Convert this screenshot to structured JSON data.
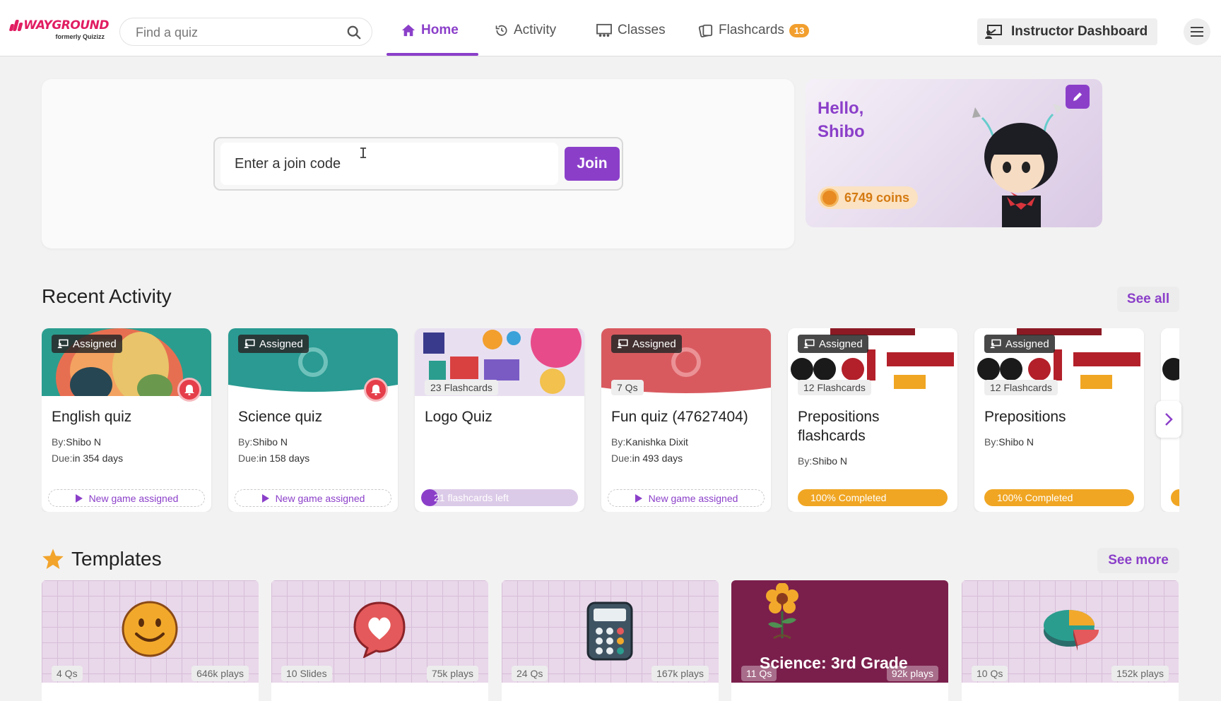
{
  "brand": {
    "name": "WAYGROUND",
    "sub": "formerly Quizizz",
    "color": "#e11d62"
  },
  "search": {
    "placeholder": "Find a quiz",
    "icon": "search-icon"
  },
  "nav": {
    "items": [
      {
        "label": "Home",
        "icon": "home-icon",
        "active": true
      },
      {
        "label": "Activity",
        "icon": "history-icon",
        "active": false
      },
      {
        "label": "Classes",
        "icon": "classes-icon",
        "active": false
      },
      {
        "label": "Flashcards",
        "icon": "flashcards-icon",
        "active": false,
        "badge": "13"
      }
    ],
    "instructor_label": "Instructor Dashboard",
    "menu_icon": "hamburger-icon"
  },
  "join": {
    "placeholder": "Enter a join code",
    "button": "Join"
  },
  "profile": {
    "greeting_line1": "Hello,",
    "greeting_line2": "Shibo",
    "coins": "6749 coins"
  },
  "recent": {
    "title": "Recent Activity",
    "see_all": "See all",
    "cards": [
      {
        "tag": "Assigned",
        "title": "English quiz",
        "by_label": "By:",
        "by": "Shibo N",
        "due_label": "Due:",
        "due": "in 354 days",
        "action": "New game assigned"
      },
      {
        "tag": "Assigned",
        "title": "Science quiz",
        "by_label": "By:",
        "by": "Shibo N",
        "due_label": "Due:",
        "due": "in 158 days",
        "action": "New game assigned"
      },
      {
        "count": "23 Flashcards",
        "title": "Logo Quiz",
        "progress_label": "21 flashcards left",
        "progress": 0.09
      },
      {
        "tag": "Assigned",
        "count": "7 Qs",
        "title": "Fun quiz (47627404)",
        "by_label": "By:",
        "by": "Kanishka Dixit",
        "due_label": "Due:",
        "due": "in 493 days",
        "action": "New game assigned"
      },
      {
        "tag": "Assigned",
        "count": "12 Flashcards",
        "title": "Prepositions flashcards",
        "by_label": "By:",
        "by": "Shibo N",
        "complete": "100% Completed"
      },
      {
        "tag": "Assigned",
        "count": "12 Flashcards",
        "title": "Prepositions",
        "by_label": "By:",
        "by": "Shibo N",
        "complete": "100% Completed"
      }
    ]
  },
  "templates": {
    "title": "Templates",
    "see_more": "See more",
    "items": [
      {
        "left": "4 Qs",
        "right": "646k plays",
        "icon": "smiley-icon"
      },
      {
        "left": "10 Slides",
        "right": "75k plays",
        "icon": "heart-bubble-icon"
      },
      {
        "left": "24 Qs",
        "right": "167k plays",
        "icon": "calculator-icon"
      },
      {
        "left": "11 Qs",
        "right": "92k plays",
        "icon": "flower-icon",
        "title": "Science: 3rd Grade"
      },
      {
        "left": "10 Qs",
        "right": "152k plays",
        "icon": "pie-chart-icon"
      }
    ]
  },
  "colors": {
    "accent": "#8b3fc9",
    "orange": "#f0a623",
    "red": "#e53e4a"
  }
}
